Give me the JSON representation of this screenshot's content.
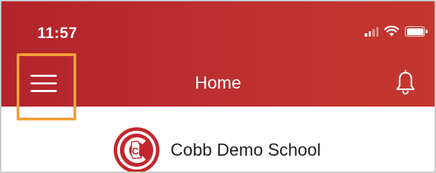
{
  "status_bar": {
    "time": "11:57",
    "icons": [
      "signal-icon",
      "wifi-icon",
      "battery-icon"
    ]
  },
  "header": {
    "title": "Home",
    "menu_icon": "menu-icon",
    "bell_icon": "bell-icon",
    "background_color": "#b3242a",
    "highlight_color": "#f2a13a"
  },
  "school": {
    "name": "Cobb Demo School",
    "logo_icon": "school-logo",
    "logo_letter": "C"
  }
}
